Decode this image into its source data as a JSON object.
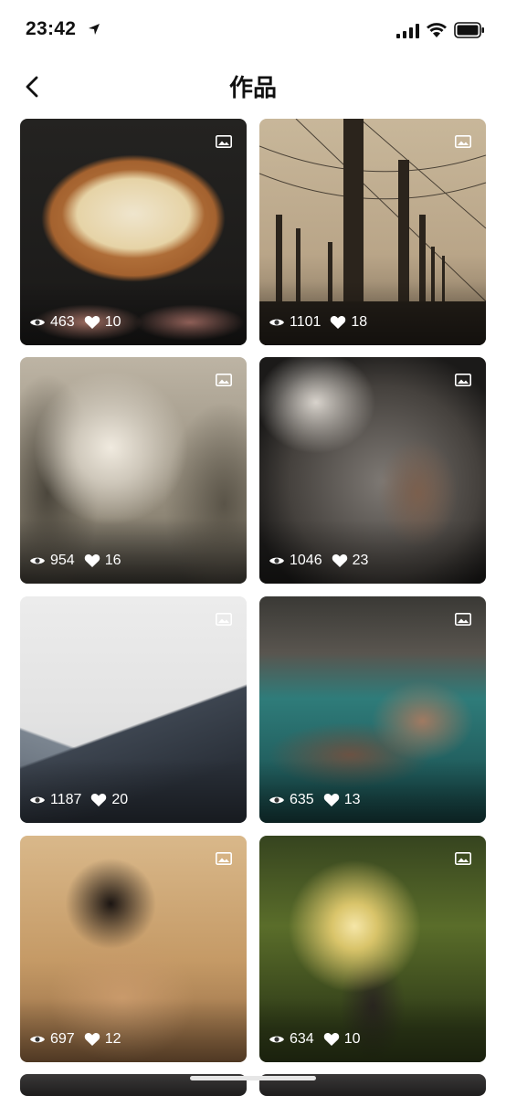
{
  "status_bar": {
    "time": "23:42"
  },
  "nav": {
    "title": "作品"
  },
  "works": [
    {
      "views": "463",
      "likes": "10"
    },
    {
      "views": "1101",
      "likes": "18"
    },
    {
      "views": "954",
      "likes": "16"
    },
    {
      "views": "1046",
      "likes": "23"
    },
    {
      "views": "1187",
      "likes": "20"
    },
    {
      "views": "635",
      "likes": "13"
    },
    {
      "views": "697",
      "likes": "12"
    },
    {
      "views": "634",
      "likes": "10"
    }
  ],
  "icons": {
    "back": "chevron-left-icon",
    "views": "eye-icon",
    "likes": "heart-icon",
    "badge": "image-icon"
  }
}
